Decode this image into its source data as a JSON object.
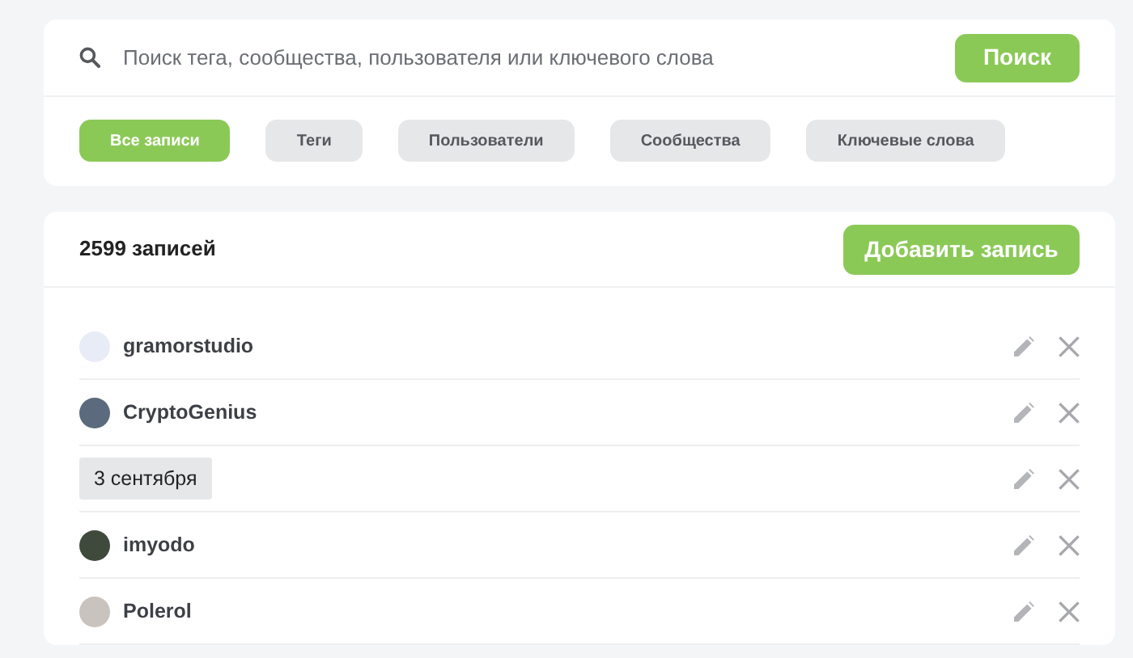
{
  "search": {
    "placeholder": "Поиск тега, сообщества, пользователя или ключевого слова",
    "button": "Поиск"
  },
  "filters": [
    {
      "label": "Все записи",
      "selected": true
    },
    {
      "label": "Теги",
      "selected": false
    },
    {
      "label": "Пользователи",
      "selected": false
    },
    {
      "label": "Сообщества",
      "selected": false
    },
    {
      "label": "Ключевые слова",
      "selected": false
    }
  ],
  "list": {
    "count": "2599 записей",
    "add_button": "Добавить запись",
    "entries": [
      {
        "kind": "user",
        "name": "gramorstudio"
      },
      {
        "kind": "user",
        "name": "CryptoGenius"
      },
      {
        "kind": "date",
        "name": "3 сентября"
      },
      {
        "kind": "user",
        "name": "imyodo"
      },
      {
        "kind": "user",
        "name": "Polerol"
      }
    ]
  }
}
